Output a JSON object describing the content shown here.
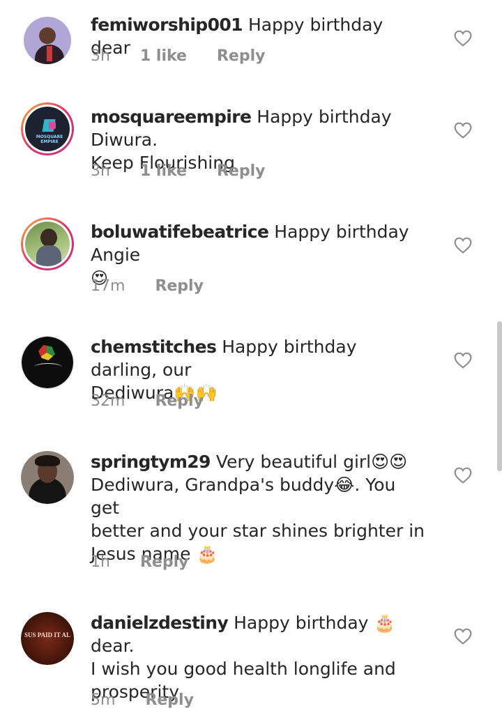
{
  "comments": [
    {
      "username": "femiworship001",
      "lines": [
        "Happy birthday dear"
      ],
      "time": "3h",
      "likes": "1 like",
      "reply": "Reply",
      "avatar": "photo of man in suit"
    },
    {
      "username": "mosquareempire",
      "lines": [
        "Happy birthday Diwura.",
        "Keep Flourishing"
      ],
      "time": "3h",
      "likes": "1 like",
      "reply": "Reply",
      "avatar_text": "MOSQUARE EMPIRE"
    },
    {
      "username": "boluwatifebeatrice",
      "lines": [
        "Happy birthday Angie",
        "😍"
      ],
      "time": "17m",
      "reply": "Reply"
    },
    {
      "username": "chemstitches",
      "lines": [
        "Happy birthday darling,  our",
        "Dediwura🙌🙌"
      ],
      "time": "32m",
      "reply": "Reply"
    },
    {
      "username": "springtym29",
      "lines": [
        "Very beautiful girl😍😍",
        "Dediwura, Grandpa's buddy😂. You get",
        "better and your star shines brighter in",
        "Jesus name 🎂"
      ],
      "time": "1h",
      "reply": "Reply"
    },
    {
      "username": "danielzdestiny",
      "lines": [
        "Happy birthday 🎂 dear.",
        "I wish you good health longlife and",
        "prosperity"
      ],
      "time": "5m",
      "reply": "Reply",
      "avatar_text": "SUS PAID IT AL"
    }
  ],
  "colors": {
    "meta": "#8e8e8e",
    "text": "#262626",
    "ring_start": "#f9b233",
    "ring_end": "#c13584"
  },
  "icons": {
    "like": "heart-outline-icon"
  }
}
